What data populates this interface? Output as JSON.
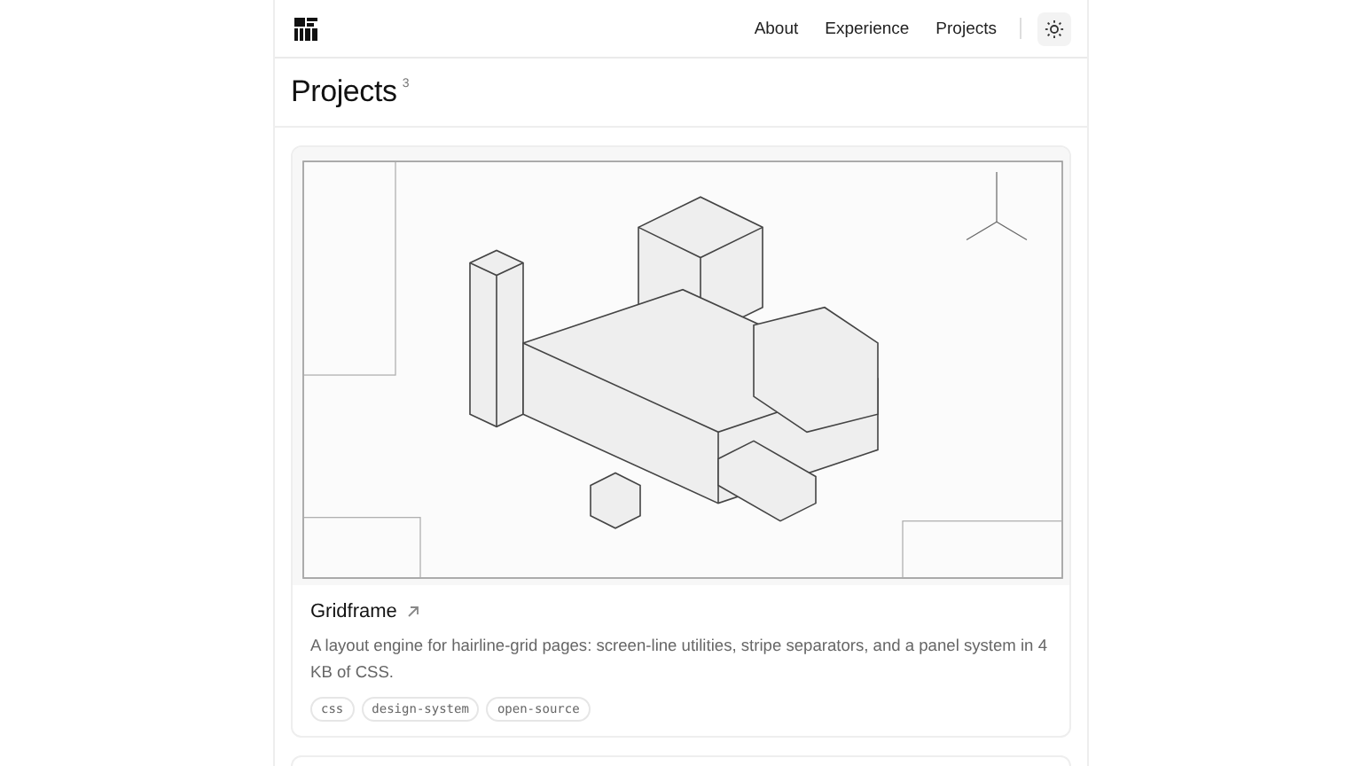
{
  "nav": {
    "items": [
      {
        "label": "About"
      },
      {
        "label": "Experience"
      },
      {
        "label": "Projects"
      }
    ]
  },
  "page": {
    "title": "Projects",
    "count": "3"
  },
  "projects": [
    {
      "title": "Gridframe",
      "description": "A layout engine for hairline-grid pages: screen-line utilities, stripe separators, and a panel system in 4 KB of CSS.",
      "tags": [
        "css",
        "design-system",
        "open-source"
      ]
    }
  ]
}
